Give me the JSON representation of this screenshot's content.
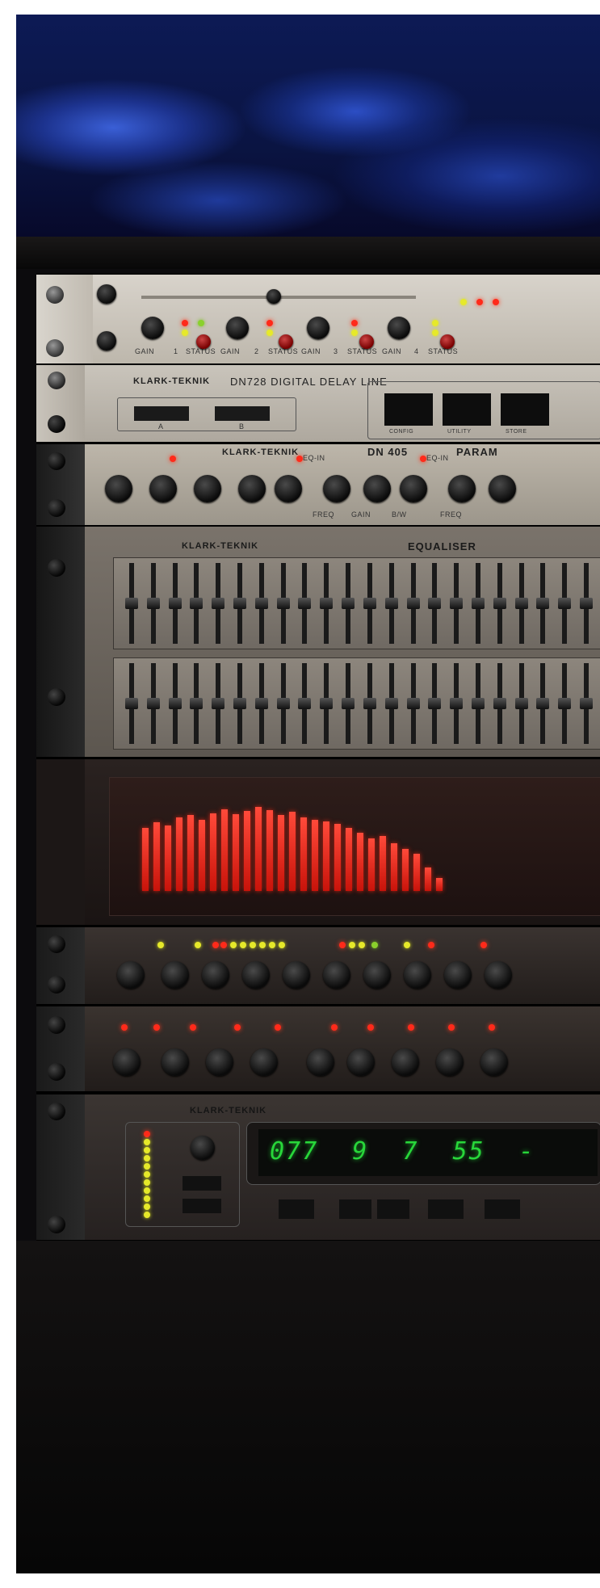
{
  "photo": {
    "units": {
      "interface": {
        "channel_labels": [
          "GAIN",
          "1",
          "STATUS",
          "GAIN",
          "2",
          "STATUS",
          "GAIN",
          "3",
          "STATUS",
          "GAIN",
          "4",
          "STATUS"
        ]
      },
      "delay": {
        "brand": "KLARK-TEKNIK",
        "title": "DN728 DIGITAL DELAY LINE",
        "label_a": "A",
        "label_b": "B",
        "btn_config": "CONFIG",
        "btn_utility": "UTILITY",
        "btn_store": "STORE"
      },
      "parametric": {
        "brand": "KLARK-TEKNIK",
        "model": "DN 405",
        "title_partial": "PARAM",
        "eq_in": "EQ-IN",
        "freq": "FREQ",
        "gain": "GAIN",
        "bw": "B/W"
      },
      "graphic": {
        "brand": "KLARK-TEKNIK",
        "title": "EQUALISER",
        "band_count": 22
      },
      "analyser": {
        "bar_levels": [
          0.6,
          0.65,
          0.62,
          0.7,
          0.72,
          0.68,
          0.74,
          0.78,
          0.73,
          0.76,
          0.8,
          0.77,
          0.72,
          0.75,
          0.7,
          0.68,
          0.66,
          0.64,
          0.6,
          0.55,
          0.5,
          0.52,
          0.45,
          0.4,
          0.35,
          0.22,
          0.12
        ]
      },
      "reverb": {
        "brand": "KLARK-TEKNIK",
        "display": "077 9 7 55 -",
        "meter_levels": [
          "red",
          "yellow",
          "yellow",
          "yellow",
          "yellow",
          "yellow",
          "yellow",
          "yellow",
          "yellow",
          "yellow",
          "yellow"
        ]
      }
    }
  }
}
